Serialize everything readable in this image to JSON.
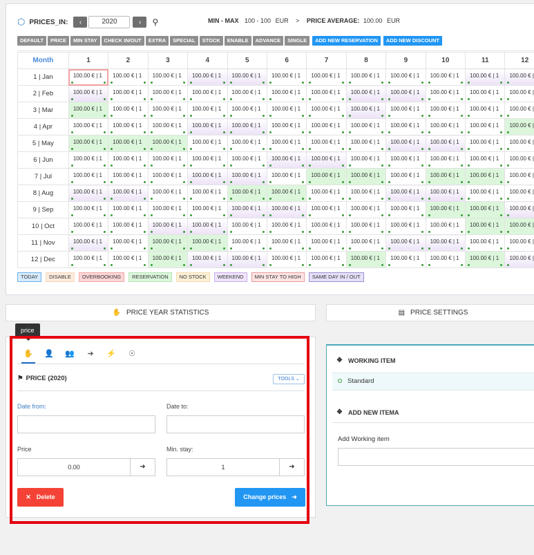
{
  "header": {
    "label": "PRICES_IN:",
    "year": "2020",
    "min_max_label": "MIN - MAX",
    "min_max_value": "100 - 100",
    "currency": "EUR",
    "arrow": ">",
    "avg_label": "PRICE AVERAGE:",
    "avg_value": "100.00",
    "avg_currency": "EUR"
  },
  "toolbar": {
    "gray_buttons": [
      "DEFAULT",
      "PRICE",
      "MIN STAY",
      "CHECK IN/OUT",
      "EXTRA",
      "SPECIAL",
      "STOCK",
      "ENABLE",
      "ADVANCE",
      "SINGLE"
    ],
    "blue_buttons": [
      "ADD NEW RESERVATION",
      "ADD NEW DISCOUNT"
    ]
  },
  "calendar": {
    "month_header": "Month",
    "day_headers": [
      "1",
      "2",
      "3",
      "4",
      "5",
      "6",
      "7",
      "8",
      "9",
      "10",
      "11",
      "12"
    ],
    "cell_text": "100.00 € | 1",
    "rows": [
      {
        "label": "1 | Jan",
        "cells": [
          "t",
          "c",
          "c",
          "p",
          "p",
          "c",
          "c",
          "c",
          "c",
          "c",
          "p",
          "p"
        ]
      },
      {
        "label": "2 | Feb",
        "cells": [
          "p",
          "c",
          "c",
          "c",
          "c",
          "c",
          "c",
          "p",
          "p",
          "c",
          "c",
          "c"
        ]
      },
      {
        "label": "3 | Mar",
        "cells": [
          "g",
          "c",
          "c",
          "c",
          "c",
          "c",
          "c",
          "p",
          "c",
          "c",
          "c",
          "c"
        ]
      },
      {
        "label": "4 | Apr",
        "cells": [
          "c",
          "c",
          "c",
          "p",
          "p",
          "c",
          "c",
          "c",
          "c",
          "c",
          "c",
          "g"
        ]
      },
      {
        "label": "5 | May",
        "cells": [
          "g",
          "g",
          "g",
          "c",
          "c",
          "c",
          "c",
          "c",
          "p",
          "p",
          "c",
          "c"
        ]
      },
      {
        "label": "6 | Jun",
        "cells": [
          "c",
          "c",
          "c",
          "c",
          "c",
          "p",
          "p",
          "c",
          "c",
          "c",
          "c",
          "c"
        ]
      },
      {
        "label": "7 | Jul",
        "cells": [
          "c",
          "c",
          "c",
          "p",
          "p",
          "c",
          "g",
          "g",
          "c",
          "g",
          "g",
          "c"
        ]
      },
      {
        "label": "8 | Aug",
        "cells": [
          "p",
          "p",
          "c",
          "c",
          "g",
          "g",
          "c",
          "c",
          "p",
          "p",
          "c",
          "c"
        ]
      },
      {
        "label": "9 | Sep",
        "cells": [
          "c",
          "c",
          "c",
          "c",
          "p",
          "p",
          "c",
          "c",
          "c",
          "g",
          "g",
          "p"
        ]
      },
      {
        "label": "10 | Oct",
        "cells": [
          "c",
          "c",
          "p",
          "p",
          "c",
          "c",
          "c",
          "c",
          "c",
          "c",
          "g",
          "g"
        ]
      },
      {
        "label": "11 | Nov",
        "cells": [
          "p",
          "c",
          "g",
          "g",
          "c",
          "c",
          "c",
          "c",
          "p",
          "p",
          "c",
          "c"
        ]
      },
      {
        "label": "12 | Dec",
        "cells": [
          "c",
          "c",
          "g",
          "p",
          "p",
          "c",
          "c",
          "g",
          "c",
          "c",
          "g",
          "p"
        ]
      }
    ]
  },
  "legend": [
    {
      "label": "TODAY",
      "bg": "#d7ebfb",
      "border": "#6aaee8"
    },
    {
      "label": "DISABLE",
      "bg": "#fdebdc",
      "border": "#f6d6bd"
    },
    {
      "label": "OVERBOOKING",
      "bg": "#fcd6d6",
      "border": "#f3a7a7"
    },
    {
      "label": "RESERVATION",
      "bg": "#dcf6dc",
      "border": "#b5e4b5"
    },
    {
      "label": "NO STOCK",
      "bg": "#fdefd5",
      "border": "#f6dbb0"
    },
    {
      "label": "WEEKEND",
      "bg": "#efe4fb",
      "border": "#c8aee9"
    },
    {
      "label": "MIN STAY TO HIGH",
      "bg": "#fde4e4",
      "border": "#e89a9a"
    },
    {
      "label": "SAME DAY IN / OUT",
      "bg": "#e6e0f8",
      "border": "#9c8fd6"
    }
  ],
  "sections": {
    "price_year_statistics": "PRICE YEAR STATISTICS",
    "price_settings": "PRICE SETTINGS"
  },
  "tooltip": "price",
  "form": {
    "title": "PRICE (2020)",
    "tools": "TOOLS",
    "date_from_label": "Date from:",
    "date_to_label": "Date to:",
    "price_label": "Price",
    "price_value": "0.00",
    "min_stay_label": "Min. stay:",
    "min_stay_value": "1",
    "delete_label": "Delete",
    "change_label": "Change prices"
  },
  "right": {
    "working_item_title": "WORKING ITEM",
    "working_item_value": "Standard",
    "add_new_title": "ADD NEW ITEMA",
    "add_working_label": "Add Working item"
  }
}
